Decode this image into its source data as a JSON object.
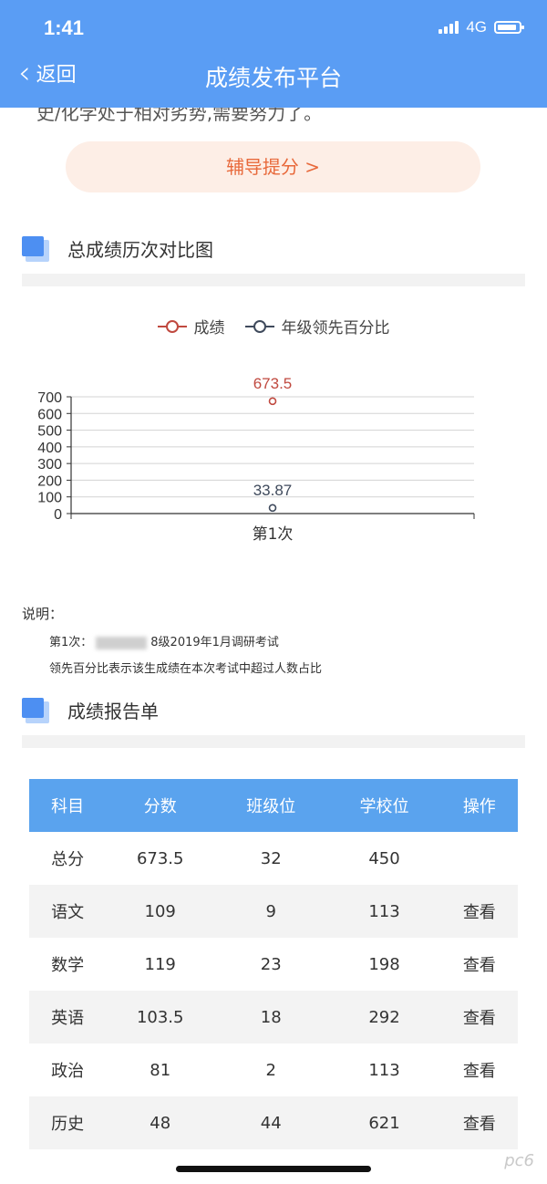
{
  "status": {
    "time": "1:41",
    "network": "4G"
  },
  "nav": {
    "back_label": "返回",
    "title": "成绩发布平台"
  },
  "intro_cut_text": "史/化学处于相对劣势,需要努力了。",
  "tutor_button_label": "辅导提分 >",
  "history_section": {
    "title": "总成绩历次对比图"
  },
  "chart_data": {
    "type": "line",
    "categories": [
      "第1次"
    ],
    "series": [
      {
        "name": "成绩",
        "values": [
          673.5
        ],
        "color": "#c0493f"
      },
      {
        "name": "年级领先百分比",
        "values": [
          33.87
        ],
        "color": "#3f4a5c"
      }
    ],
    "y_ticks": [
      0,
      100,
      200,
      300,
      400,
      500,
      600,
      700
    ],
    "ylim": [
      0,
      700
    ],
    "grid": true,
    "legend": "top-center"
  },
  "notes": {
    "heading": "说明：",
    "line1_prefix": "第1次：",
    "line1_suffix": "8级2019年1月调研考试",
    "line2": "领先百分比表示该生成绩在本次考试中超过人数占比"
  },
  "report_section": {
    "title": "成绩报告单"
  },
  "table": {
    "headers": [
      "科目",
      "分数",
      "班级位",
      "学校位",
      "操作"
    ],
    "rows": [
      {
        "subject": "总分",
        "score": "673.5",
        "class_rank": "32",
        "school_rank": "450",
        "action": ""
      },
      {
        "subject": "语文",
        "score": "109",
        "class_rank": "9",
        "school_rank": "113",
        "action": "查看"
      },
      {
        "subject": "数学",
        "score": "119",
        "class_rank": "23",
        "school_rank": "198",
        "action": "查看"
      },
      {
        "subject": "英语",
        "score": "103.5",
        "class_rank": "18",
        "school_rank": "292",
        "action": "查看"
      },
      {
        "subject": "政治",
        "score": "81",
        "class_rank": "2",
        "school_rank": "113",
        "action": "查看"
      },
      {
        "subject": "历史",
        "score": "48",
        "class_rank": "44",
        "school_rank": "621",
        "action": "查看"
      }
    ]
  },
  "watermark": "pc6"
}
